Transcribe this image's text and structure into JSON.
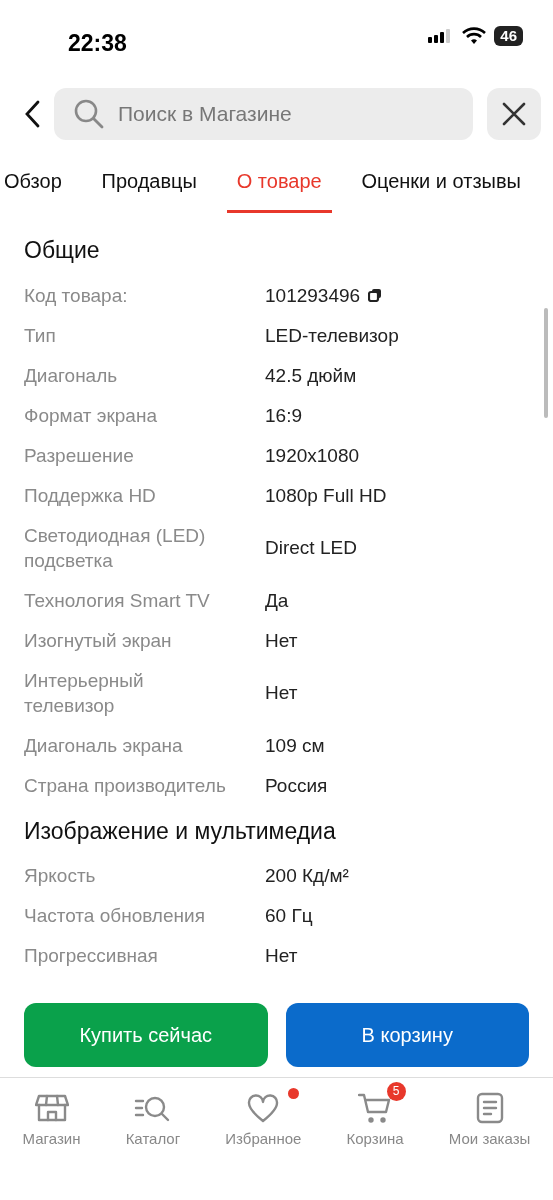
{
  "status_bar": {
    "time": "22:38",
    "battery": "46"
  },
  "search": {
    "placeholder": "Поиск в Магазине"
  },
  "tabs": [
    {
      "label": "Обзор",
      "selected": false
    },
    {
      "label": "Продавцы",
      "selected": false
    },
    {
      "label": "О товаре",
      "selected": true
    },
    {
      "label": "Оценки и отзывы",
      "selected": false
    }
  ],
  "sections": [
    {
      "title": "Общие",
      "rows": [
        {
          "label": "Код товара:",
          "value": "101293496",
          "copyable": true
        },
        {
          "label": "Тип",
          "value": "LED-телевизор"
        },
        {
          "label": "Диагональ",
          "value": "42.5 дюйм"
        },
        {
          "label": "Формат экрана",
          "value": "16:9"
        },
        {
          "label": "Разрешение",
          "value": "1920x1080"
        },
        {
          "label": "Поддержка HD",
          "value": "1080p Full HD"
        },
        {
          "label": "Светодиодная (LED) подсветка",
          "value": "Direct LED"
        },
        {
          "label": "Технология Smart TV",
          "value": "Да"
        },
        {
          "label": "Изогнутый экран",
          "value": "Нет"
        },
        {
          "label": "Интерьерный телевизор",
          "value": "Нет"
        },
        {
          "label": "Диагональ экрана",
          "value": "109 см"
        },
        {
          "label": "Страна производитель",
          "value": "Россия"
        }
      ]
    },
    {
      "title": "Изображение и мультимедиа",
      "rows": [
        {
          "label": "Яркость",
          "value": "200 Кд/м²"
        },
        {
          "label": "Частота обновления",
          "value": "60 Гц"
        },
        {
          "label": "Прогрессивная",
          "value": "Нет"
        }
      ]
    }
  ],
  "buttons": [
    {
      "label": "Купить сейчас",
      "kind": "buy"
    },
    {
      "label": "В корзину",
      "kind": "cart"
    }
  ],
  "bottom_nav": [
    {
      "label": "Магазин",
      "kind": "store"
    },
    {
      "label": "Каталог",
      "kind": "catalog"
    },
    {
      "label": "Избранное",
      "kind": "heart",
      "dot": true
    },
    {
      "label": "Корзина",
      "kind": "cart",
      "badge": "5"
    },
    {
      "label": "Мои заказы",
      "kind": "orders"
    }
  ]
}
